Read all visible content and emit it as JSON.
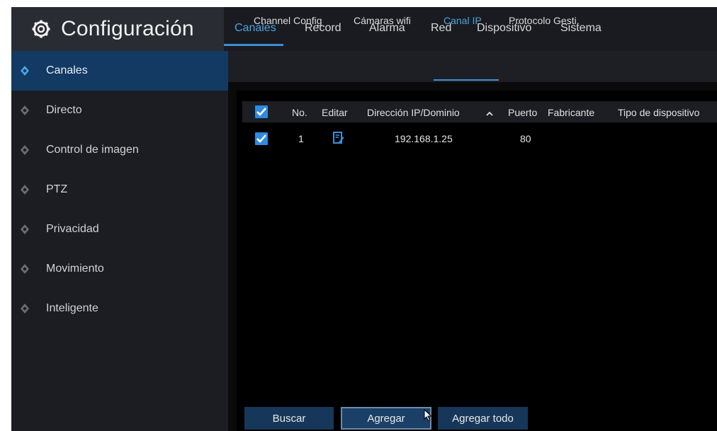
{
  "app": {
    "title": "Configuración"
  },
  "top_tabs": [
    {
      "label": "Canales",
      "active": true
    },
    {
      "label": "Record",
      "active": false
    },
    {
      "label": "Alarma",
      "active": false
    },
    {
      "label": "Red",
      "active": false
    },
    {
      "label": "Dispositivo",
      "active": false
    },
    {
      "label": "Sistema",
      "active": false
    }
  ],
  "sidebar": {
    "items": [
      {
        "label": "Canales",
        "active": true
      },
      {
        "label": "Directo",
        "active": false
      },
      {
        "label": "Control de imagen",
        "active": false
      },
      {
        "label": "PTZ",
        "active": false
      },
      {
        "label": "Privacidad",
        "active": false
      },
      {
        "label": "Movimiento",
        "active": false
      },
      {
        "label": "Inteligente",
        "active": false
      }
    ]
  },
  "sub_tabs": [
    {
      "label": "Channel Config",
      "active": false
    },
    {
      "label": "Cámaras wifi",
      "active": false
    },
    {
      "label": "Canal IP",
      "active": true
    },
    {
      "label": "Protocolo Gesti.",
      "active": false
    }
  ],
  "table": {
    "select_all_checked": true,
    "columns": [
      "No.",
      "Editar",
      "Dirección IP/Dominio",
      "Puerto",
      "Fabricante",
      "Tipo de dispositivo"
    ],
    "sort_column": "Dirección IP/Dominio",
    "sort_direction": "ascending",
    "rows": [
      {
        "checked": true,
        "no": "1",
        "ip": "192.168.1.25",
        "port": "80",
        "manufacturer": "",
        "device_type": ""
      }
    ]
  },
  "buttons": {
    "search": "Buscar",
    "add": "Agregar",
    "add_all": "Agregar todo"
  },
  "colors": {
    "accent": "#3c8fd6",
    "active_text": "#4aa3df",
    "checkbox": "#2f8be0",
    "sidebar_active": "#123a62",
    "button_bg": "#16375a"
  }
}
